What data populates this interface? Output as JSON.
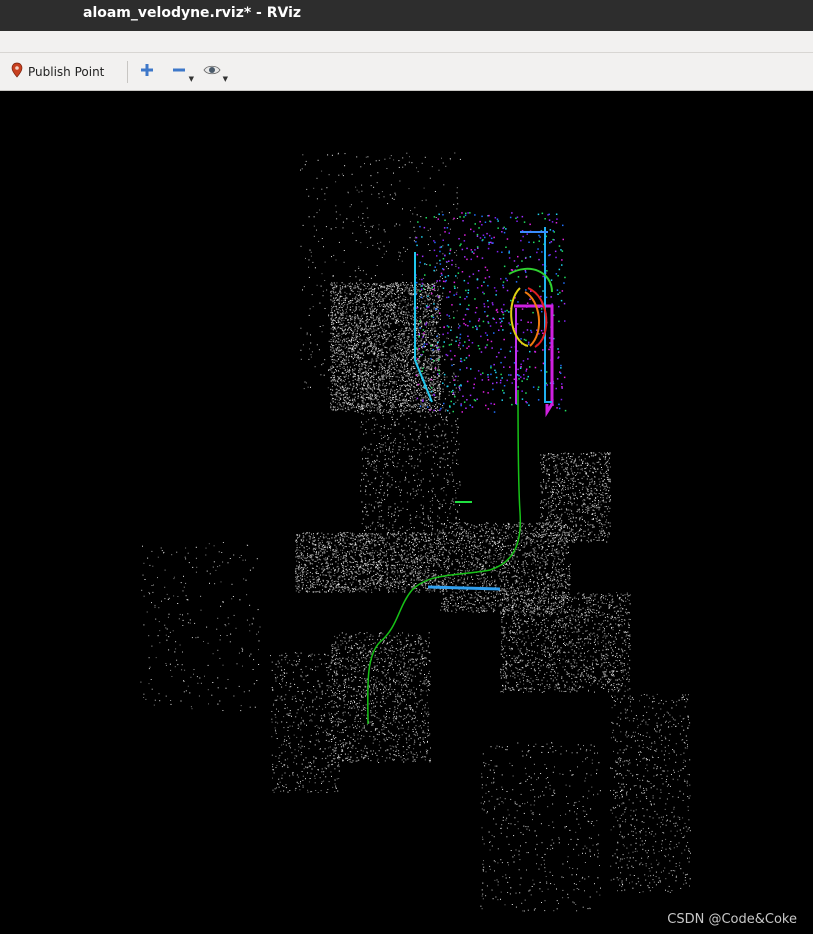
{
  "window": {
    "title": "aloam_velodyne.rviz* - RViz"
  },
  "toolbar": {
    "publish_point_label": "Publish Point",
    "icons": [
      "map-pin-icon",
      "plus-icon",
      "minus-icon",
      "eye-icon"
    ]
  },
  "viewport": {
    "background_color": "#000000",
    "trajectory_color": "#17c217",
    "watermark": "CSDN @Code&Coke"
  }
}
